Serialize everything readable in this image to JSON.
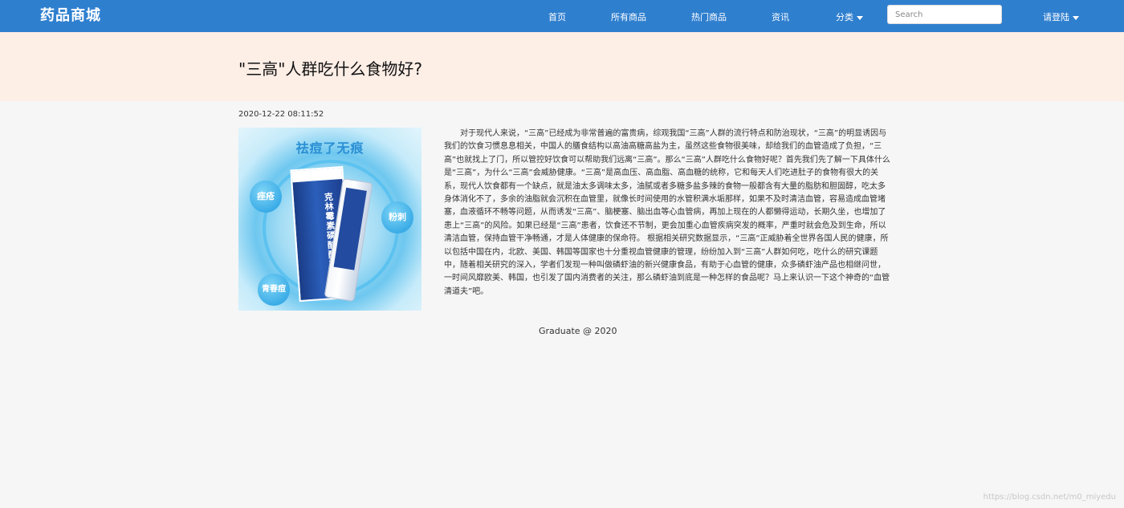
{
  "nav": {
    "brand": "药品商城",
    "links": [
      "首页",
      "所有商品",
      "热门商品",
      "资讯"
    ],
    "category_label": "分类",
    "search_placeholder": "Search",
    "login_label": "请登陆"
  },
  "article": {
    "title": "\"三高\"人群吃什么食物好?",
    "date": "2020-12-22 08:11:52",
    "image": {
      "caption": "祛痘了无痕",
      "bubbles": [
        "痤疮",
        "粉刺",
        "青春痘"
      ],
      "box_label": "克林霉素磷酸酯凝胶"
    },
    "body": "对于现代人来说，“三高”已经成为非常普遍的富贵病，综观我国“三高”人群的流行特点和防治现状，“三高”的明显诱因与我们的饮食习惯息息相关，中国人的膳食结构以高油高糖高盐为主，虽然这些食物很美味，却给我们的血管造成了负担，“三高”也就找上了门，所以管控好饮食可以帮助我们远离“三高”。那么“三高”人群吃什么食物好呢？首先我们先了解一下具体什么是“三高”，为什么“三高”会威胁健康。“三高”是高血压、高血脂、高血糖的统称，它和每天人们吃进肚子的食物有很大的关系，现代人饮食都有一个缺点，就是油太多调味太多，油腻或者多糖多盐多辣的食物一般都含有大量的脂肪和胆固醇，吃太多身体消化不了，多余的油脂就会沉积在血管里，就像长时间使用的水管积满水垢那样，如果不及时清洁血管，容易造成血管堵塞，血液循环不畅等问题，从而诱发“三高”、脑梗塞、脑出血等心血管病，再加上现在的人都懒得运动，长期久坐，也增加了患上“三高”的风险。如果已经是“三高”患者，饮食还不节制，更会加重心血管疾病突发的概率，严重时就会危及到生命，所以清洁血管，保持血管干净畅通，才是人体健康的保命符。 根据相关研究数据显示，“三高”正威胁着全世界各国人民的健康，所以包括中国在内，北欧、美国、韩国等国家也十分重视血管健康的管理，纷纷加入到“三高”人群如何吃，吃什么的研究课题中，随着相关研究的深入，学者们发现一种叫做磷虾油的新兴健康食品，有助于心血管的健康，众多磷虾油产品也相继问世，一时间风靡欧美、韩国，也引发了国内消费者的关注，那么磷虾油到底是一种怎样的食品呢？马上来认识一下这个神奇的“血管清道夫”吧。"
  },
  "footer": {
    "text": "Graduate @ 2020"
  },
  "watermark": "https://blog.csdn.net/m0_miyedu"
}
